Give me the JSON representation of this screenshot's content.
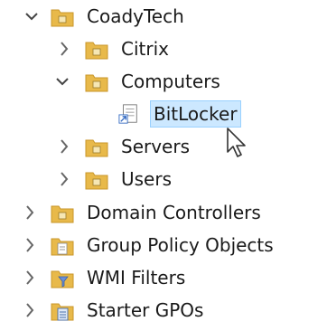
{
  "tree": {
    "root": {
      "label": "CoadyTech",
      "expanded": true
    },
    "citrix": {
      "label": "Citrix",
      "expanded": false
    },
    "computers": {
      "label": "Computers",
      "expanded": true
    },
    "bitlocker": {
      "label": "BitLocker",
      "selected": true
    },
    "servers": {
      "label": "Servers",
      "expanded": false
    },
    "users": {
      "label": "Users",
      "expanded": false
    },
    "domain_controllers": {
      "label": "Domain Controllers",
      "expanded": false
    },
    "group_policy_objects": {
      "label": "Group Policy Objects",
      "expanded": false
    },
    "wmi_filters": {
      "label": "WMI Filters",
      "expanded": false
    },
    "starter_gpos": {
      "label": "Starter GPOs",
      "expanded": false
    }
  },
  "colors": {
    "selection_bg": "#cce8ff",
    "selection_border": "#99d1ff",
    "folder": "#e8b94a",
    "folder_dark": "#c9962a"
  }
}
